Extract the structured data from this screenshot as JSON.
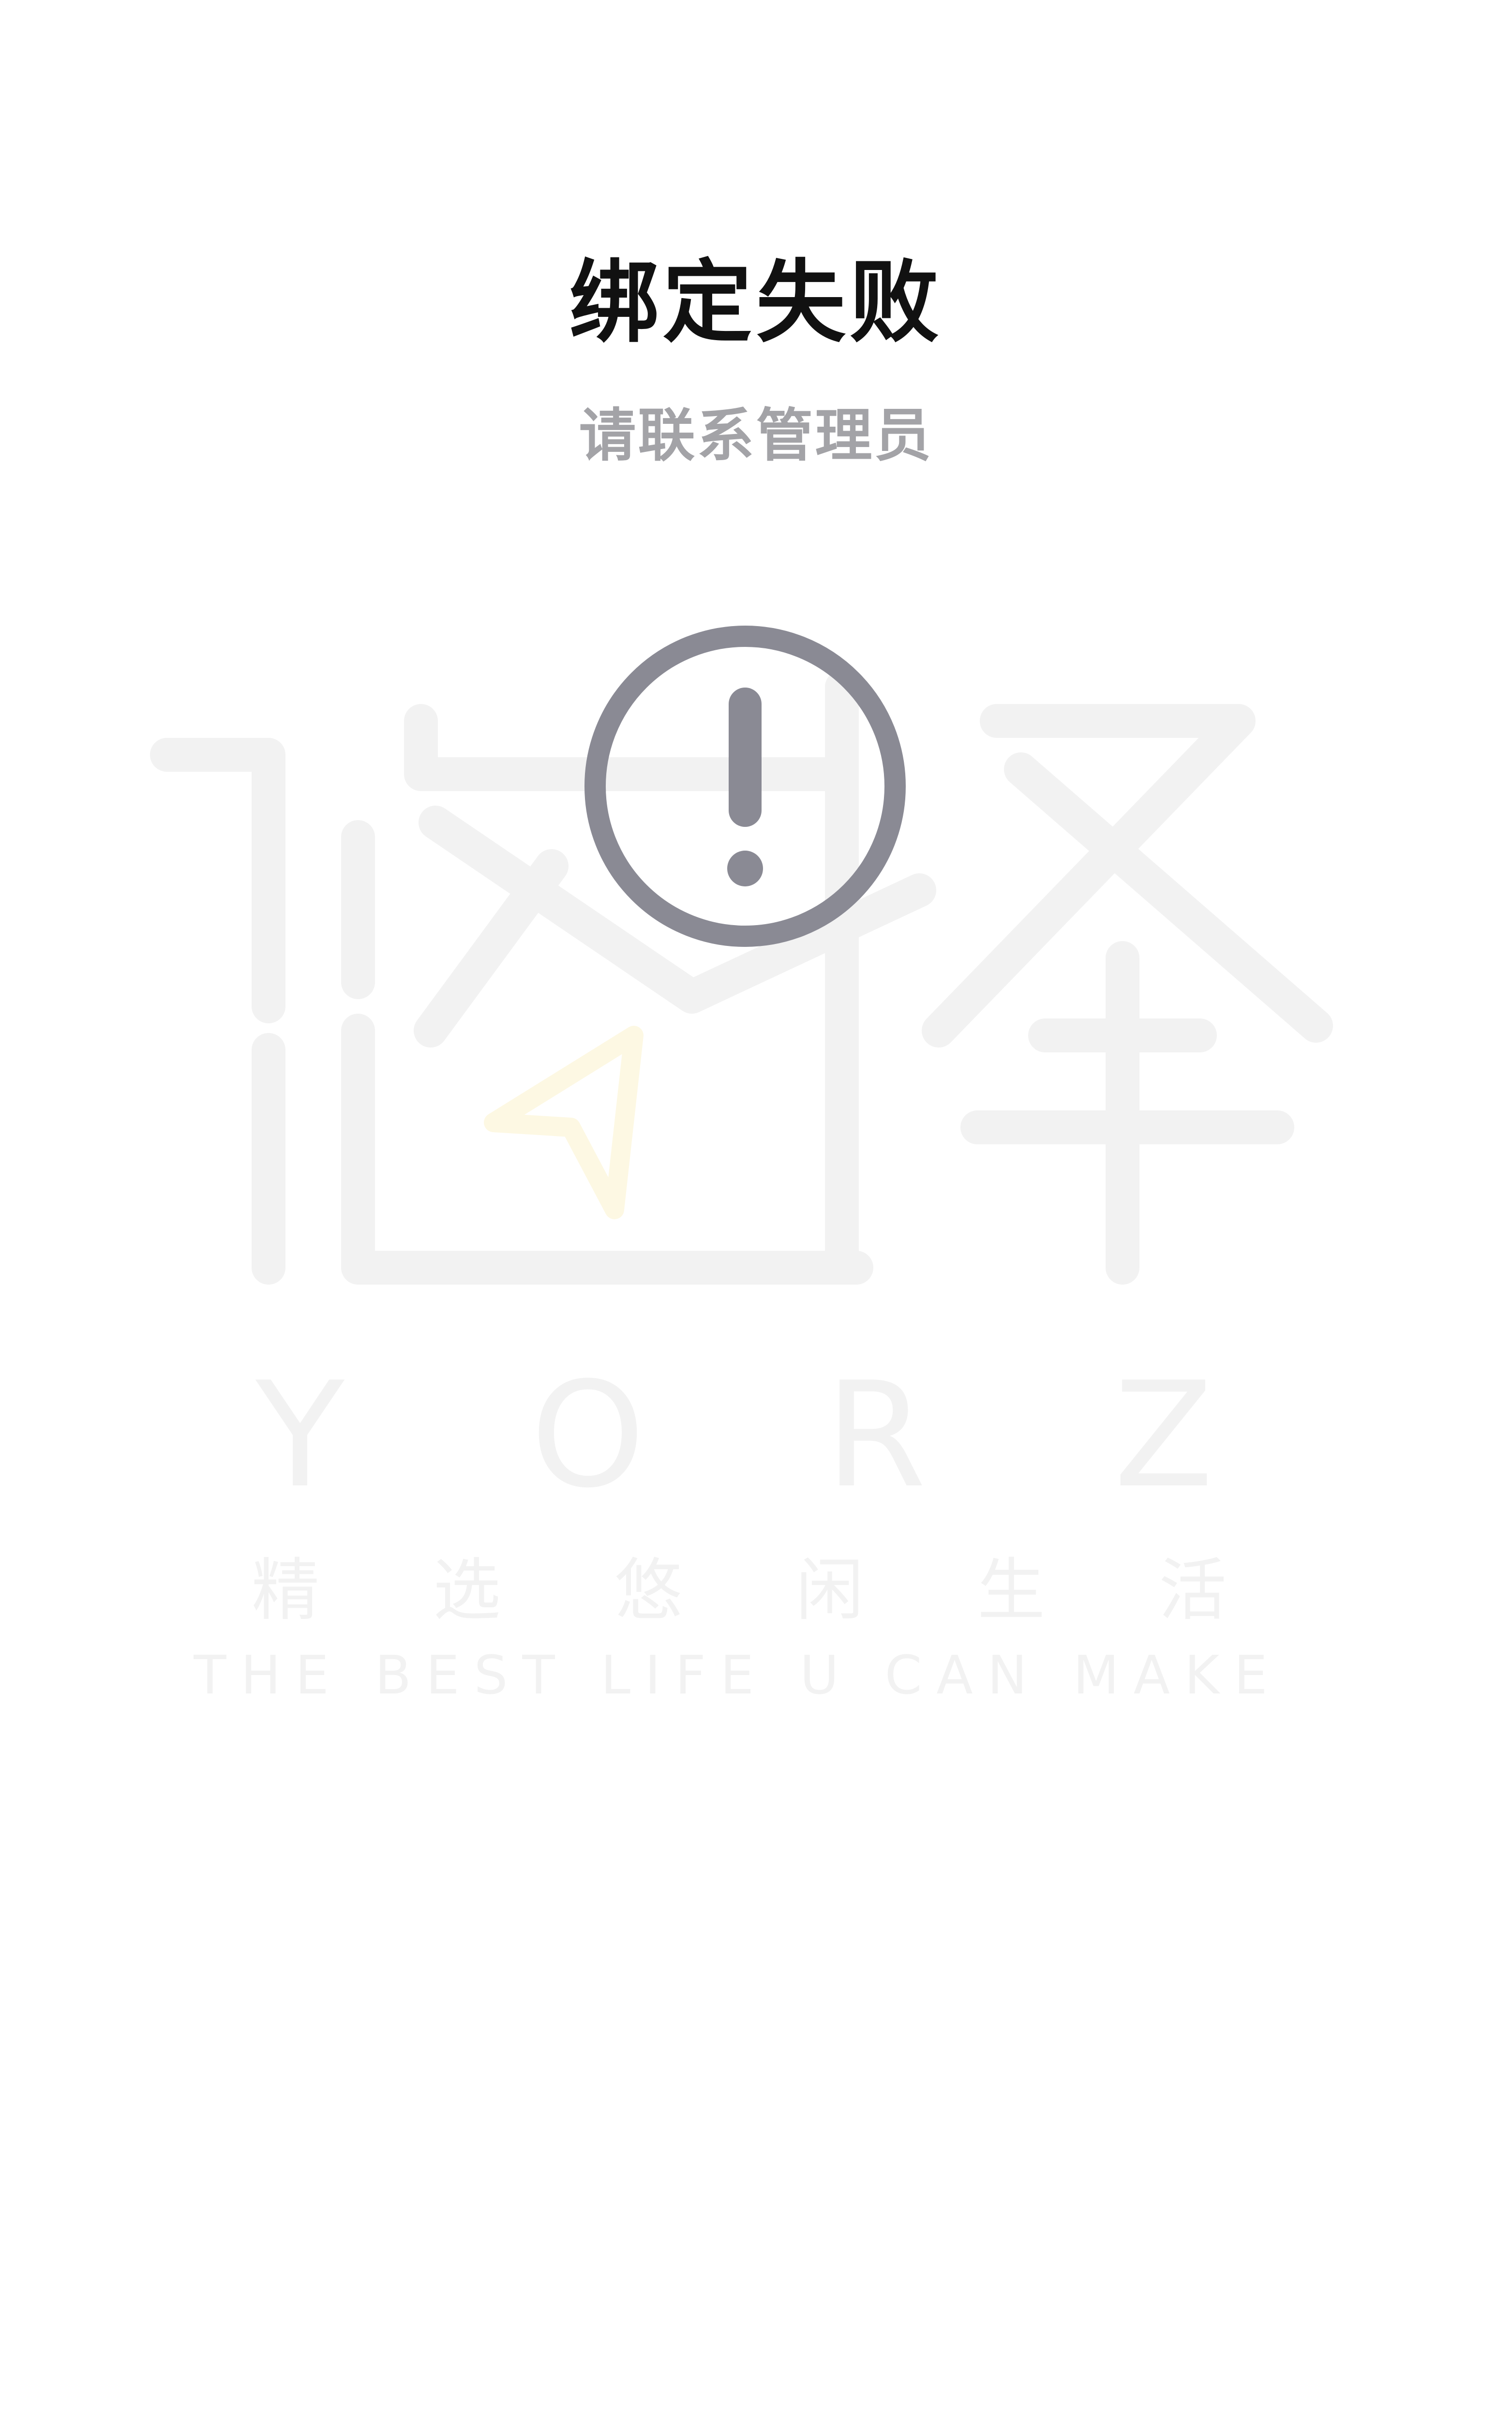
{
  "status": {
    "title": "绑定失败",
    "message": "请联系管理员",
    "icon": "exclamation-circle-icon",
    "icon_color": "#8a8a94"
  },
  "watermark": {
    "logo_chars": "悠择",
    "brand_letters": [
      "Y",
      "O",
      "R",
      "Z"
    ],
    "slogan_cn": [
      "精",
      "选",
      "悠",
      "闲",
      "生",
      "活"
    ],
    "slogan_en": "THE BEST LIFE U CAN MAKE",
    "color": "#f2f2f2",
    "accent_color": "#fdf8e3"
  }
}
